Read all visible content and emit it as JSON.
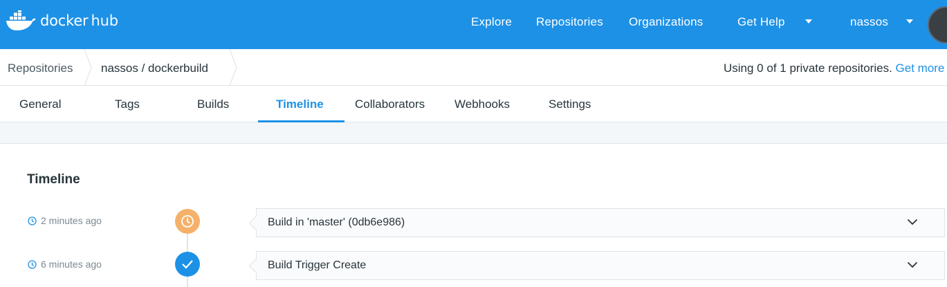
{
  "brand": {
    "name": "docker",
    "sub": "hub",
    "color": "#1d91e6"
  },
  "nav": {
    "explore": "Explore",
    "repositories": "Repositories",
    "organizations": "Organizations",
    "get_help": "Get Help",
    "user": "nassos"
  },
  "breadcrumb": {
    "root": "Repositories",
    "current": "nassos / dockerbuild"
  },
  "usage": {
    "text": "Using 0 of 1 private repositories.",
    "link": "Get more"
  },
  "tabs": [
    {
      "label": "General"
    },
    {
      "label": "Tags"
    },
    {
      "label": "Builds"
    },
    {
      "label": "Timeline",
      "active": true
    },
    {
      "label": "Collaborators"
    },
    {
      "label": "Webhooks"
    },
    {
      "label": "Settings"
    }
  ],
  "timeline": {
    "title": "Timeline",
    "events": [
      {
        "time": "2 minutes ago",
        "status": "pending",
        "status_icon": "clock-icon",
        "color": "#f5b16a",
        "text": "Build in 'master' (0db6e986)"
      },
      {
        "time": "6 minutes ago",
        "status": "success",
        "status_icon": "check-icon",
        "color": "#1d91e6",
        "text": "Build Trigger Create"
      }
    ]
  }
}
